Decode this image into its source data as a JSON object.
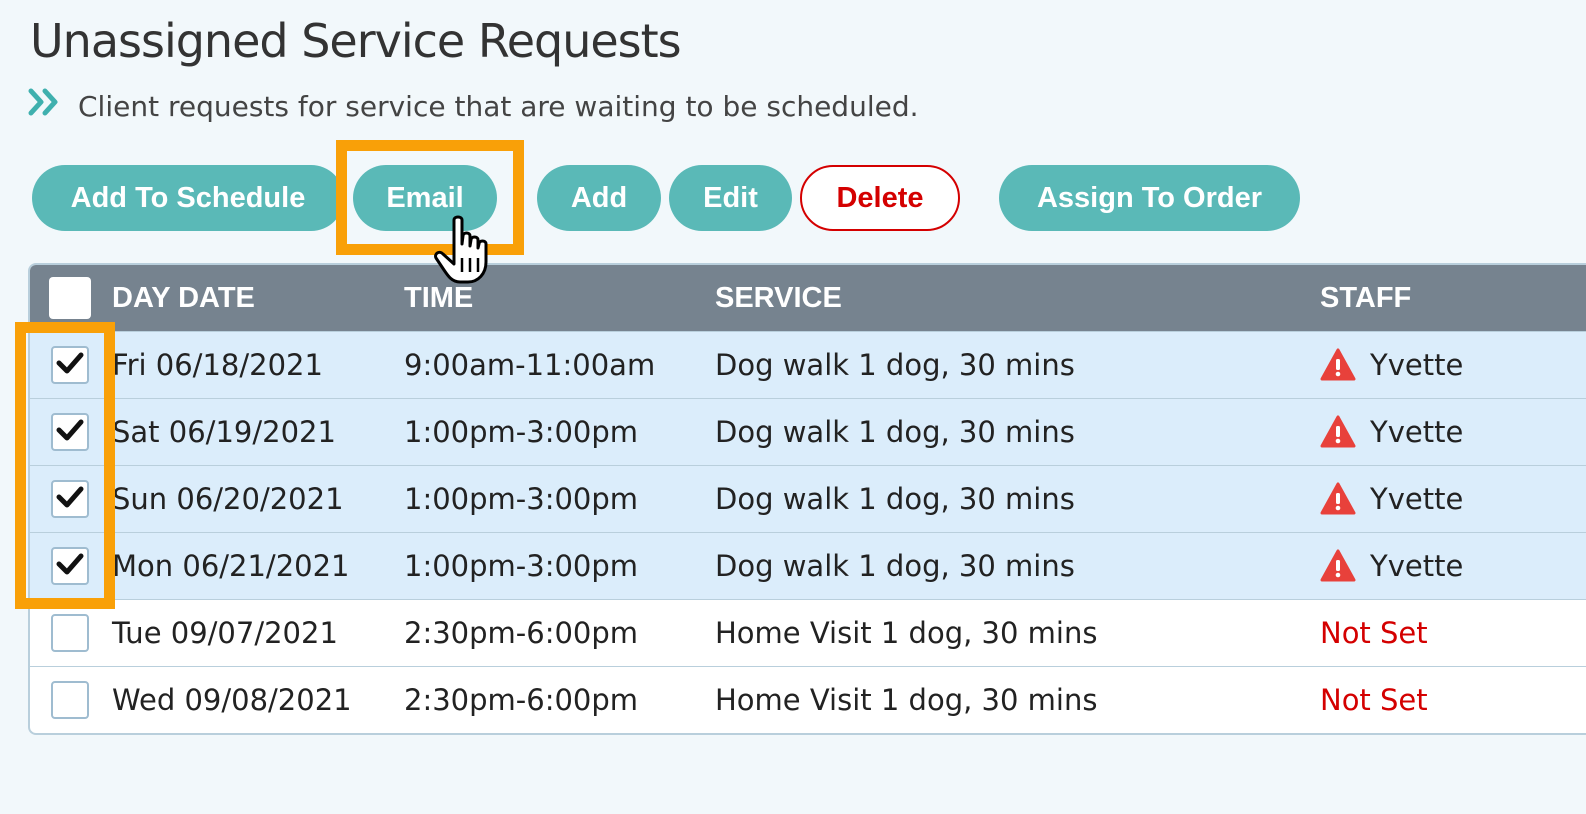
{
  "page": {
    "title": "Unassigned Service Requests",
    "subtitle": "Client requests for service that are waiting to be scheduled."
  },
  "toolbar": {
    "add_to_schedule": "Add To Schedule",
    "email": "Email",
    "add": "Add",
    "edit": "Edit",
    "delete": "Delete",
    "assign_to_order": "Assign To Order"
  },
  "table": {
    "headers": {
      "day_date": "DAY DATE",
      "time": "TIME",
      "service": "SERVICE",
      "staff": "STAFF"
    },
    "rows": [
      {
        "checked": true,
        "day_date": "Fri 06/18/2021",
        "time": "9:00am-11:00am",
        "service": "Dog walk 1 dog, 30 mins",
        "staff": "Yvette",
        "warning": true
      },
      {
        "checked": true,
        "day_date": "Sat 06/19/2021",
        "time": "1:00pm-3:00pm",
        "service": "Dog walk 1 dog, 30 mins",
        "staff": "Yvette",
        "warning": true
      },
      {
        "checked": true,
        "day_date": "Sun 06/20/2021",
        "time": "1:00pm-3:00pm",
        "service": "Dog walk 1 dog, 30 mins",
        "staff": "Yvette",
        "warning": true
      },
      {
        "checked": true,
        "day_date": "Mon 06/21/2021",
        "time": "1:00pm-3:00pm",
        "service": "Dog walk 1 dog, 30 mins",
        "staff": "Yvette",
        "warning": true
      },
      {
        "checked": false,
        "day_date": "Tue 09/07/2021",
        "time": "2:30pm-6:00pm",
        "service": "Home Visit 1 dog, 30 mins",
        "staff": "Not Set",
        "warning": false
      },
      {
        "checked": false,
        "day_date": "Wed 09/08/2021",
        "time": "2:30pm-6:00pm",
        "service": "Home Visit 1 dog, 30 mins",
        "staff": "Not Set",
        "warning": false
      }
    ]
  },
  "colors": {
    "accent": "#5ab9b7",
    "highlight": "#f9a008",
    "danger": "#d40000",
    "header_bg": "#76838f",
    "selected_row_bg": "#dbedfb"
  },
  "icons": {
    "subtitle": "double-chevron-right-icon",
    "warning": "warning-triangle-icon",
    "check": "checkmark-icon",
    "cursor": "hand-pointer-icon"
  }
}
